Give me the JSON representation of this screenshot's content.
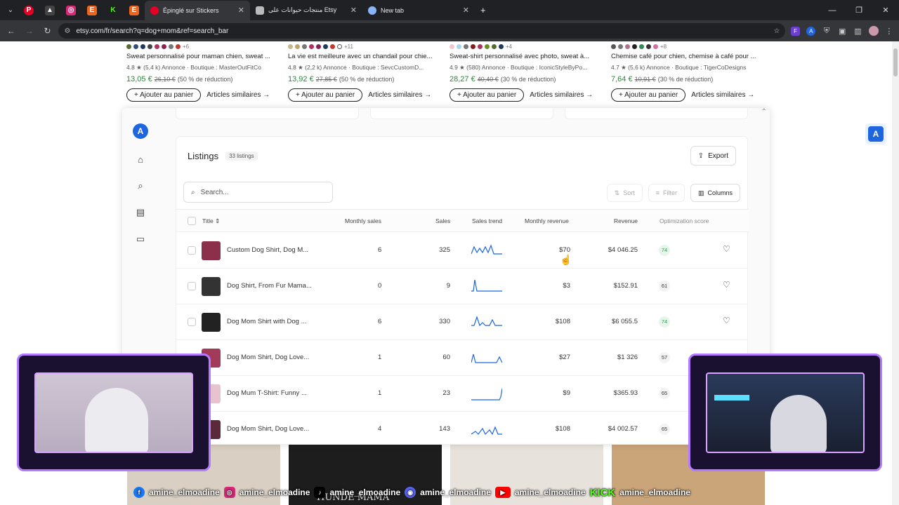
{
  "browser": {
    "tabs": [
      {
        "label": "Épinglé sur Stickers",
        "active": true
      },
      {
        "label": "منتجات حيوانات على Etsy",
        "active": false
      },
      {
        "label": "New tab",
        "active": false
      }
    ],
    "url": "etsy.com/fr/search?q=dog+mom&ref=search_bar"
  },
  "products": [
    {
      "more": "+6",
      "title": "Sweat personnalisé pour maman chien, sweat ...",
      "meta": "4.8 ★ (5,4 k) Annonce · Boutique : MasterOutFitCo",
      "price": "13,05 €",
      "old": "26,10 €",
      "discount": "(50 % de réduction)",
      "cart": "Ajouter au panier",
      "similar": "Articles similaires →"
    },
    {
      "more": "+11",
      "title": "La vie est meilleure avec un chandail pour chie...",
      "meta": "4.8 ★ (2,2 k) Annonce · Boutique : SevcCustomD...",
      "price": "13,92 €",
      "old": "27,85 €",
      "discount": "(50 % de réduction)",
      "cart": "Ajouter au panier",
      "similar": "Articles similaires →"
    },
    {
      "more": "+4",
      "title": "Sweat-shirt personnalisé avec photo, sweat à...",
      "meta": "4.9 ★ (580) Annonce · Boutique : IconicStyleByPo...",
      "price": "28,27 €",
      "old": "40,40 €",
      "discount": "(30 % de réduction)",
      "cart": "Ajouter au panier",
      "similar": "Articles similaires →"
    },
    {
      "more": "+8",
      "title": "Chemise café pour chien, chemise à café pour ...",
      "meta": "4.7 ★ (5,6 k) Annonce · Boutique : TigerCoDesigns",
      "price": "7,64 €",
      "old": "10,91 €",
      "discount": "(30 % de réduction)",
      "cart": "Ajouter au panier",
      "similar": "Articles similaires →"
    }
  ],
  "listings": {
    "title": "Listings",
    "count": "33 listings",
    "export": "Export",
    "search_placeholder": "Search...",
    "sort": "Sort",
    "filter": "Filter",
    "columns": "Columns",
    "headers": {
      "title": "Title",
      "monthly_sales": "Monthly sales",
      "sales": "Sales",
      "sales_trend": "Sales trend",
      "monthly_revenue": "Monthly revenue",
      "revenue": "Revenue",
      "optimization": "Optimization score"
    },
    "rows": [
      {
        "title": "Custom Dog Shirt, Dog M...",
        "monthly_sales": "6",
        "sales": "325",
        "monthly_revenue": "$70",
        "revenue": "$4 046.25",
        "score": "74"
      },
      {
        "title": "Dog Shirt, From Fur Mama...",
        "monthly_sales": "0",
        "sales": "9",
        "monthly_revenue": "$3",
        "revenue": "$152.91",
        "score": "61"
      },
      {
        "title": "Dog Mom Shirt with Dog ...",
        "monthly_sales": "6",
        "sales": "330",
        "monthly_revenue": "$108",
        "revenue": "$6 055.5",
        "score": "74"
      },
      {
        "title": "Dog Mom Shirt, Dog Love...",
        "monthly_sales": "1",
        "sales": "60",
        "monthly_revenue": "$27",
        "revenue": "$1 326",
        "score": "57"
      },
      {
        "title": "Dog Mum T-Shirt: Funny ...",
        "monthly_sales": "1",
        "sales": "23",
        "monthly_revenue": "$9",
        "revenue": "$365.93",
        "score": "65"
      },
      {
        "title": "Dog Mom Shirt, Dog Love...",
        "monthly_sales": "4",
        "sales": "143",
        "monthly_revenue": "$108",
        "revenue": "$4 002.57",
        "score": "65"
      }
    ]
  },
  "stream": {
    "handles": [
      "amine_elmoadine",
      "amine_elmoadine",
      "amine_elmoadine",
      "amine_elmoadine",
      "amine_elmoadine",
      "amine_elmoadine"
    ],
    "kick": "KICK",
    "shirt_text": "HUNDE MAMA"
  },
  "colors": {
    "etsy_orange": "#f1641e",
    "accent_blue": "#1e66e0",
    "score_green": "#2a9d4a",
    "stream_purple": "#b57bff"
  }
}
